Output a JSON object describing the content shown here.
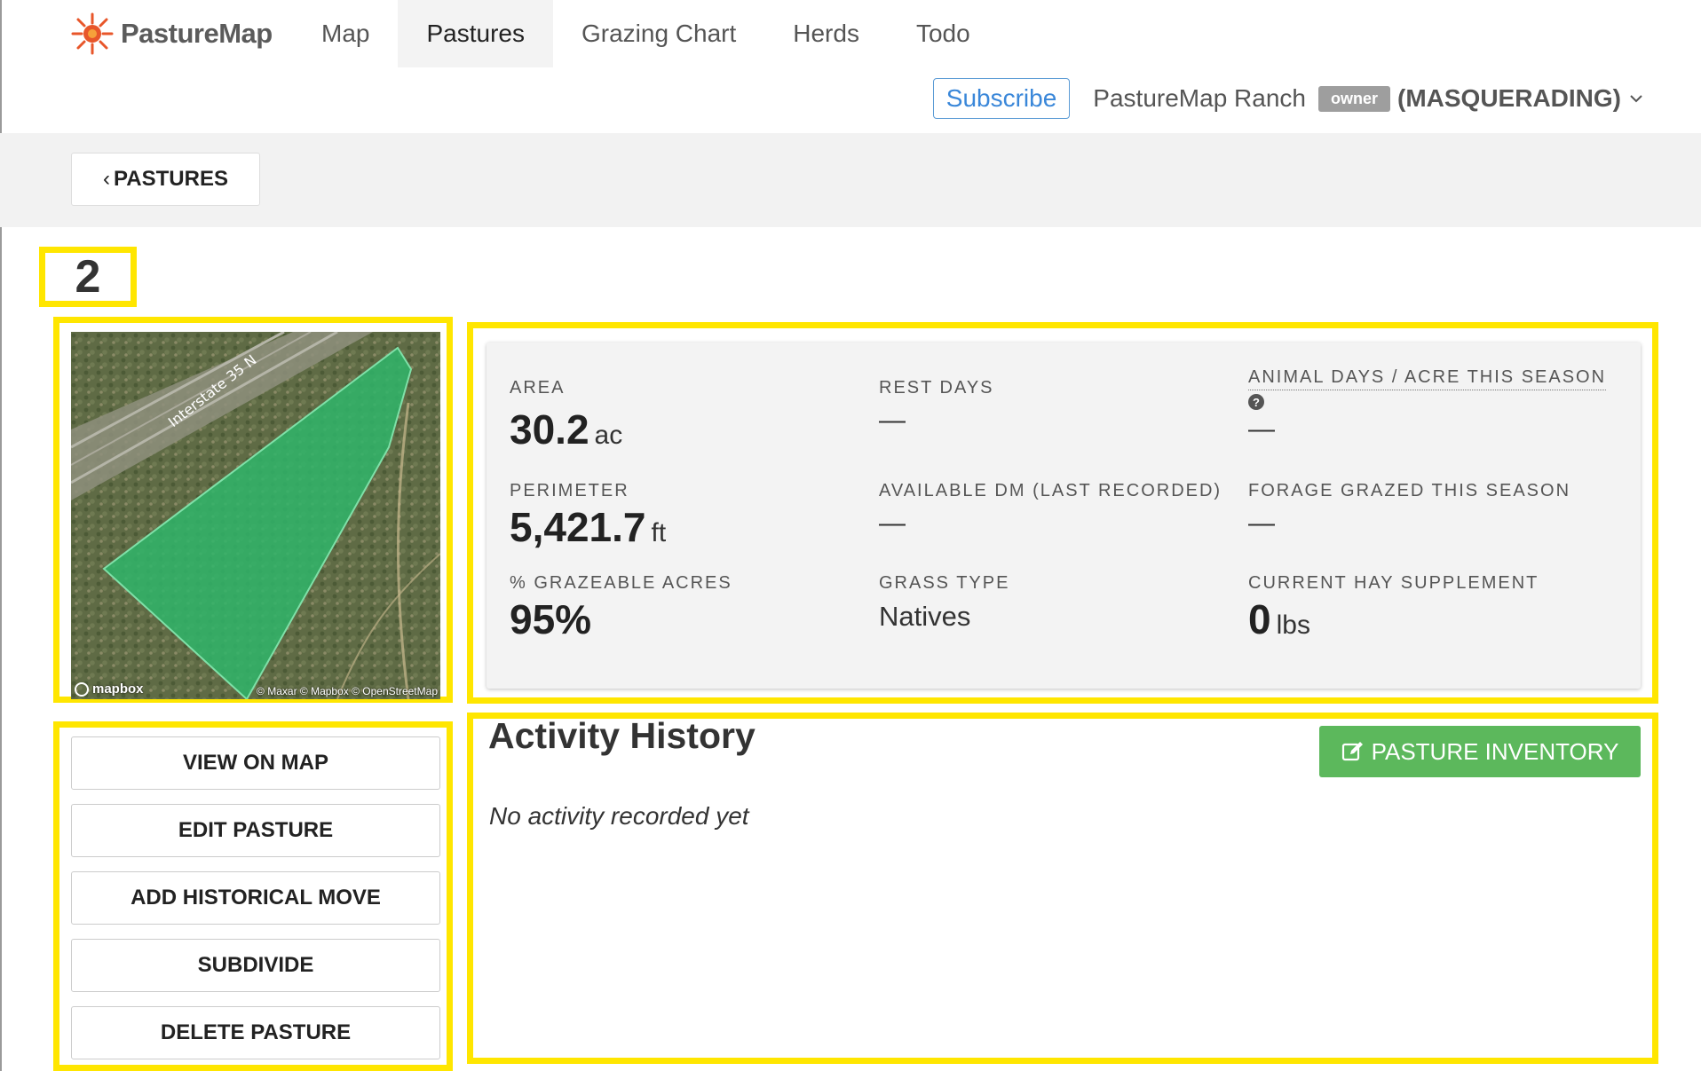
{
  "app": {
    "brand": "PastureMap"
  },
  "nav": {
    "tabs": [
      {
        "label": "Map"
      },
      {
        "label": "Pastures"
      },
      {
        "label": "Grazing Chart"
      },
      {
        "label": "Herds"
      },
      {
        "label": "Todo"
      }
    ],
    "active_tab": "Pastures"
  },
  "account": {
    "subscribe_label": "Subscribe",
    "ranch_name": "PastureMap Ranch",
    "role_badge": "owner",
    "masquerade": "(MASQUERADING)"
  },
  "back": {
    "label": "PASTURES"
  },
  "pasture": {
    "name": "2"
  },
  "map": {
    "road_label": "Interstate 35 N",
    "logo": "mapbox",
    "attribution": "© Maxar © Mapbox © OpenStreetMap",
    "polygon_color": "#2fb56a"
  },
  "stats": {
    "area": {
      "label": "AREA",
      "value": "30.2",
      "unit": "ac"
    },
    "rest_days": {
      "label": "REST DAYS",
      "value": "—"
    },
    "animal_days": {
      "label": "ANIMAL DAYS / ACRE THIS SEASON",
      "value": "—"
    },
    "perimeter": {
      "label": "PERIMETER",
      "value": "5,421.7",
      "unit": "ft"
    },
    "available_dm": {
      "label": "AVAILABLE DM (LAST RECORDED)",
      "value": "—"
    },
    "forage_grazed": {
      "label": "FORAGE GRAZED THIS SEASON",
      "value": "—"
    },
    "grazeable": {
      "label": "% GRAZEABLE ACRES",
      "value": "95%"
    },
    "grass_type": {
      "label": "GRASS TYPE",
      "value": "Natives"
    },
    "hay_supplement": {
      "label": "CURRENT HAY SUPPLEMENT",
      "value": "0",
      "unit": "lbs"
    }
  },
  "actions": {
    "view_on_map": "VIEW ON MAP",
    "edit_pasture": "EDIT PASTURE",
    "add_historical_move": "ADD HISTORICAL MOVE",
    "subdivide": "SUBDIVIDE",
    "delete_pasture": "DELETE PASTURE"
  },
  "activity": {
    "title": "Activity History",
    "inventory_button": "PASTURE INVENTORY",
    "empty_message": "No activity recorded yet"
  },
  "colors": {
    "highlight": "#ffe600",
    "primary_green": "#5cb85c",
    "subscribe_blue": "#3a87d9"
  }
}
